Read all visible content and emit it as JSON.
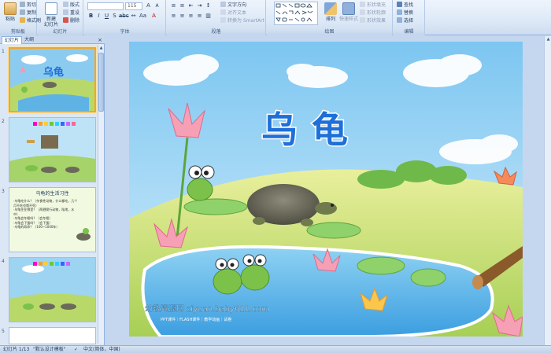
{
  "ribbon": {
    "clipboard": {
      "label": "剪贴板",
      "paste": "粘贴",
      "cut": "剪切",
      "copy": "复制",
      "format_painter": "格式刷"
    },
    "slides": {
      "label": "幻灯片",
      "new_slide": "新建\n幻灯片",
      "layout": "版式",
      "reset": "重设",
      "delete": "删除"
    },
    "font": {
      "label": "字体",
      "font_size": "115"
    },
    "paragraph": {
      "label": "段落",
      "text_direction": "文字方向",
      "align_text": "对齐文本",
      "smartart": "转换为 SmartArt"
    },
    "drawing": {
      "label": "绘图",
      "arrange": "排列",
      "quick_styles": "快速样式",
      "shape_fill": "形状填充",
      "shape_outline": "形状轮廓",
      "shape_effects": "形状效果"
    },
    "editing": {
      "label": "编辑",
      "find": "查找",
      "replace": "替换",
      "select": "选择"
    }
  },
  "pane": {
    "tab_slides": "幻灯片",
    "tab_outline": "大纲",
    "close": "×",
    "slides": [
      {
        "num": "1"
      },
      {
        "num": "2"
      },
      {
        "num": "3",
        "title": "乌龟的生活习性",
        "lines": [
          "·乌龟吃什么？（杂食性动物，什么都吃，几个月不吃也饿不死）",
          "·乌龟住在哪里？（两栖爬行动物，陆地，水中）",
          "·乌龟会冬眠吗？（会冬眠）",
          "·乌龟会下蛋吗？（会下蛋）",
          "·乌龟的寿命？（100~1000年）"
        ]
      },
      {
        "num": "4"
      },
      {
        "num": "5"
      }
    ]
  },
  "slide": {
    "title": "乌龟",
    "watermark": "幼教资源网 ziyuan.baby611.com",
    "watermark_small": "PPT课件｜FLASH课件｜教学动画｜试卷"
  },
  "status": {
    "slide_count": "幻灯片 1/13",
    "theme": "\"默认设计模板\"",
    "language": "中文(简体，中国)"
  },
  "colors": {
    "ribbon_border": "#8db2e3",
    "title_blue": "#1f6fd8",
    "selected_border": "#f5a623"
  }
}
